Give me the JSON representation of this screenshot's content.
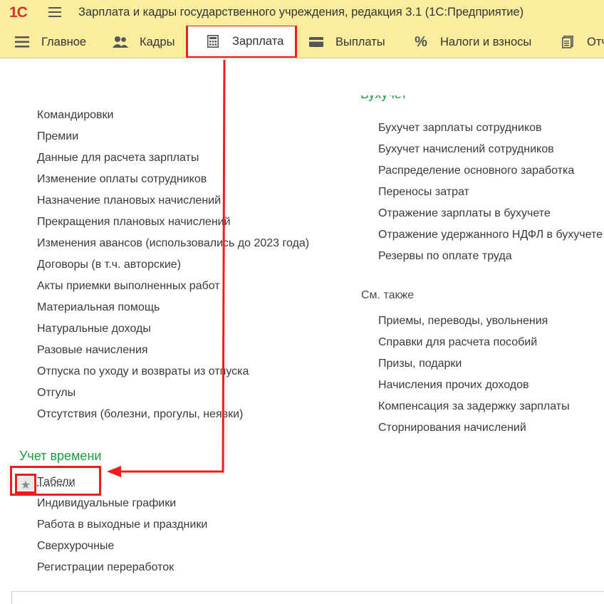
{
  "app": {
    "logo": "1С",
    "title": "Зарплата и кадры государственного учреждения, редакция 3.1  (1С:Предприятие)"
  },
  "nav": {
    "items": [
      {
        "label": "Главное",
        "icon": "list-icon"
      },
      {
        "label": "Кадры",
        "icon": "people-icon"
      },
      {
        "label": "Зарплата",
        "icon": "calculator-icon",
        "active": true
      },
      {
        "label": "Выплаты",
        "icon": "wallet-icon"
      },
      {
        "label": "Налоги и взносы",
        "icon": "percent-icon"
      },
      {
        "label": "Отч",
        "icon": "reports-icon"
      }
    ]
  },
  "left_links": [
    "Командировки",
    "Премии",
    "Данные для расчета зарплаты",
    "Изменение оплаты сотрудников",
    "Назначение плановых начислений",
    "Прекращения плановых начислений",
    "Изменения авансов (использовались до 2023 года)",
    "Договоры (в т.ч. авторские)",
    "Акты приемки выполненных работ",
    "Материальная помощь",
    "Натуральные доходы",
    "Разовые начисления",
    "Отпуска по уходу и возвраты из отпуска",
    "Отгулы",
    "Отсутствия (болезни, прогулы, неявки)"
  ],
  "time_group": {
    "title": "Учет времени",
    "links": [
      "Табели",
      "Индивидуальные графики",
      "Работа в выходные и праздники",
      "Сверхурочные",
      "Регистрации переработок"
    ]
  },
  "right_group": {
    "title": "Бухучет",
    "links": [
      "Бухучет зарплаты сотрудников",
      "Бухучет начислений сотрудников",
      "Распределение основного заработка",
      "Переносы затрат",
      "Отражение зарплаты в бухучете",
      "Отражение удержанного НДФЛ в бухучете",
      "Резервы по оплате труда"
    ]
  },
  "see_also": {
    "title": "См. также",
    "links": [
      "Приемы, переводы, увольнения",
      "Справки для расчета пособий",
      "Призы, подарки",
      "Начисления прочих доходов",
      "Компенсация за задержку зарплаты",
      "Сторнирования начислений"
    ]
  },
  "colors": {
    "header_bg": "#fbed9e",
    "highlight": "#ee1c1c",
    "group_title": "#1a9a40"
  }
}
